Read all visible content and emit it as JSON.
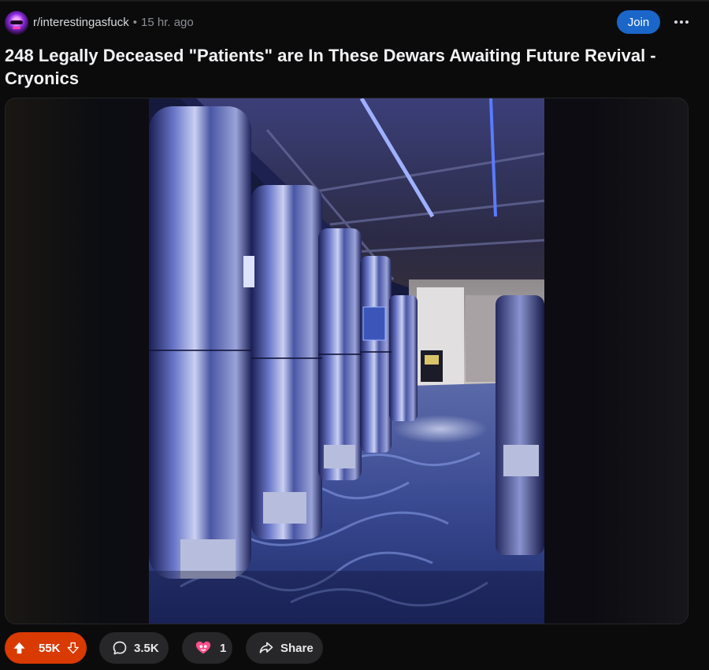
{
  "post": {
    "subreddit": "r/interestingasfuck",
    "separator": "•",
    "time_ago": "15 hr. ago",
    "join_label": "Join",
    "title": "248 Legally Deceased \"Patients\" are In These Dewars Awaiting Future Revival - Cryonics"
  },
  "actions": {
    "votes": "55K",
    "comments": "3.5K",
    "awards": "1",
    "share_label": "Share"
  },
  "colors": {
    "upvoted": "#d93a00",
    "join": "#1b66c9",
    "pill": "#272729",
    "background": "#0b0b0c"
  },
  "icons": {
    "more": "more-horizontal-icon",
    "upvote": "upvote-arrow-icon",
    "downvote": "downvote-arrow-icon",
    "comment": "comment-bubble-icon",
    "award": "award-icon",
    "share": "share-arrow-icon"
  }
}
